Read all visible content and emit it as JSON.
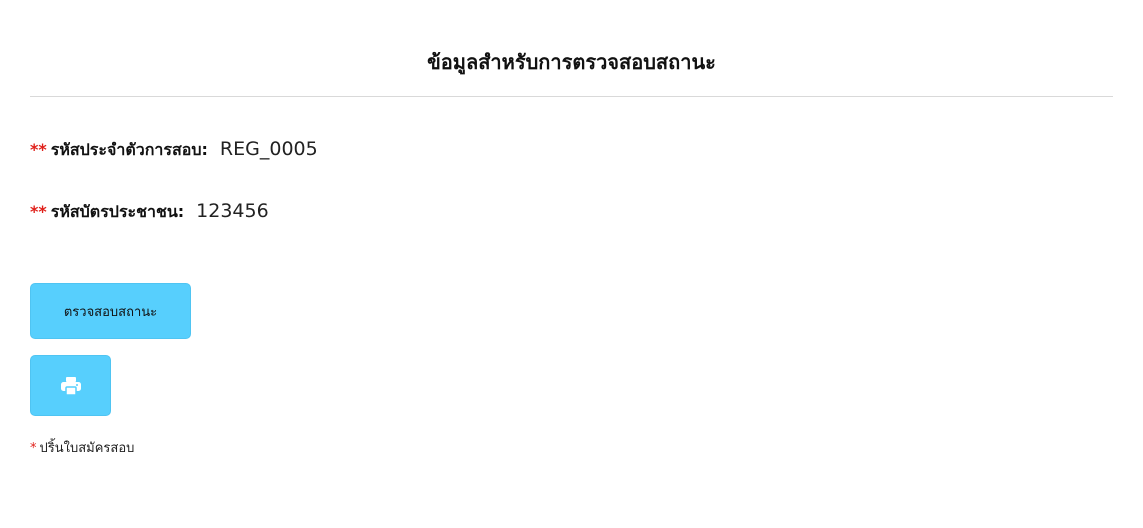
{
  "page": {
    "title": "ข้อมูลสำหรับการตรวจสอบสถานะ"
  },
  "fields": [
    {
      "required_mark": "**",
      "label": "รหัสประจำตัวการสอบ:",
      "value": "REG_0005"
    },
    {
      "required_mark": "**",
      "label": "รหัสบัตรประชาชน:",
      "value": "123456"
    }
  ],
  "actions": {
    "check_status_label": "ตรวจสอบสถานะ",
    "print_icon": "printer-icon",
    "button_color": "#57cffd"
  },
  "note": {
    "mark": "*",
    "text": "ปริ้นใบสมัครสอบ"
  },
  "colors": {
    "required": "#e0201a",
    "divider": "#d9d9d9"
  }
}
